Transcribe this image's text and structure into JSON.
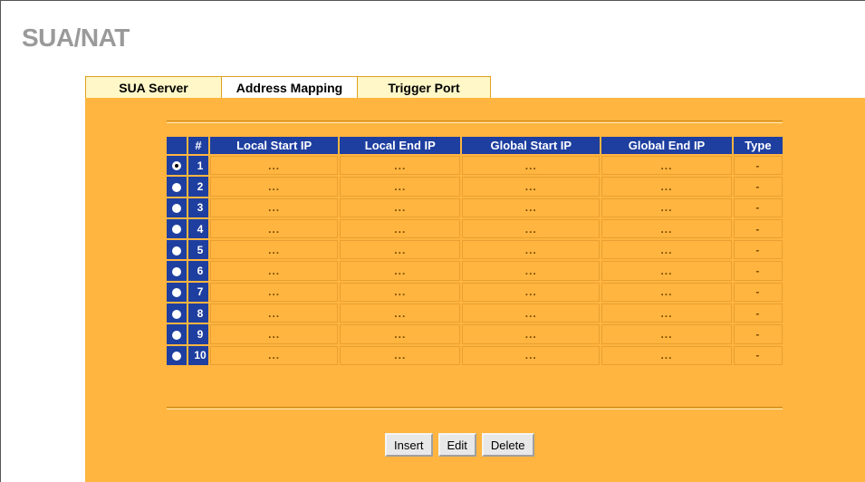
{
  "page": {
    "title": "SUA/NAT"
  },
  "tabs": [
    {
      "label": "SUA Server",
      "active": false
    },
    {
      "label": "Address Mapping",
      "active": true
    },
    {
      "label": "Trigger Port",
      "active": false
    }
  ],
  "table": {
    "headers": [
      "#",
      "Local Start IP",
      "Local End IP",
      "Global Start IP",
      "Global End IP",
      "Type"
    ],
    "selected_row": 1,
    "rows": [
      {
        "index": "1",
        "local_start": "...",
        "local_end": "...",
        "global_start": "...",
        "global_end": "...",
        "type": "-"
      },
      {
        "index": "2",
        "local_start": "...",
        "local_end": "...",
        "global_start": "...",
        "global_end": "...",
        "type": "-"
      },
      {
        "index": "3",
        "local_start": "...",
        "local_end": "...",
        "global_start": "...",
        "global_end": "...",
        "type": "-"
      },
      {
        "index": "4",
        "local_start": "...",
        "local_end": "...",
        "global_start": "...",
        "global_end": "...",
        "type": "-"
      },
      {
        "index": "5",
        "local_start": "...",
        "local_end": "...",
        "global_start": "...",
        "global_end": "...",
        "type": "-"
      },
      {
        "index": "6",
        "local_start": "...",
        "local_end": "...",
        "global_start": "...",
        "global_end": "...",
        "type": "-"
      },
      {
        "index": "7",
        "local_start": "...",
        "local_end": "...",
        "global_start": "...",
        "global_end": "...",
        "type": "-"
      },
      {
        "index": "8",
        "local_start": "...",
        "local_end": "...",
        "global_start": "...",
        "global_end": "...",
        "type": "-"
      },
      {
        "index": "9",
        "local_start": "...",
        "local_end": "...",
        "global_start": "...",
        "global_end": "...",
        "type": "-"
      },
      {
        "index": "10",
        "local_start": "...",
        "local_end": "...",
        "global_start": "...",
        "global_end": "...",
        "type": "-"
      }
    ]
  },
  "buttons": {
    "insert": "Insert",
    "edit": "Edit",
    "delete": "Delete"
  },
  "colors": {
    "panel": "#ffb540",
    "header": "#1e3fa0",
    "tab_border": "#e0a020"
  }
}
